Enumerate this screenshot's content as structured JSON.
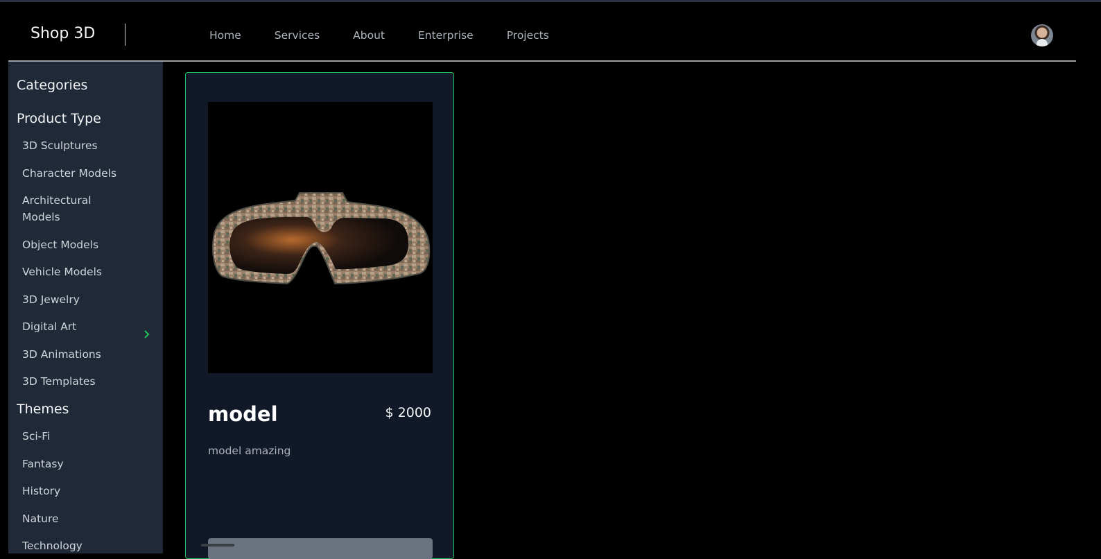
{
  "brand": {
    "name": "Shop 3D"
  },
  "nav": {
    "items": [
      "Home",
      "Services",
      "About",
      "Enterprise",
      "Projects"
    ]
  },
  "sidebar": {
    "title": "Categories",
    "product_type": {
      "title": "Product Type",
      "items": [
        "3D Sculptures",
        "Character Models",
        "Architectural Models",
        "Object Models",
        "Vehicle Models",
        "3D Jewelry",
        "Digital Art",
        "3D Animations",
        "3D Templates"
      ]
    },
    "themes": {
      "title": "Themes",
      "items": [
        "Sci-Fi",
        "Fantasy",
        "History",
        "Nature",
        "Technology"
      ]
    }
  },
  "product": {
    "name": "model",
    "price": "$ 2000",
    "description": "model amazing",
    "image": "camouflage-goggles"
  },
  "colors": {
    "accent_border": "#22c55e",
    "sidebar_bg": "#1f2937",
    "card_bg": "#111827"
  }
}
